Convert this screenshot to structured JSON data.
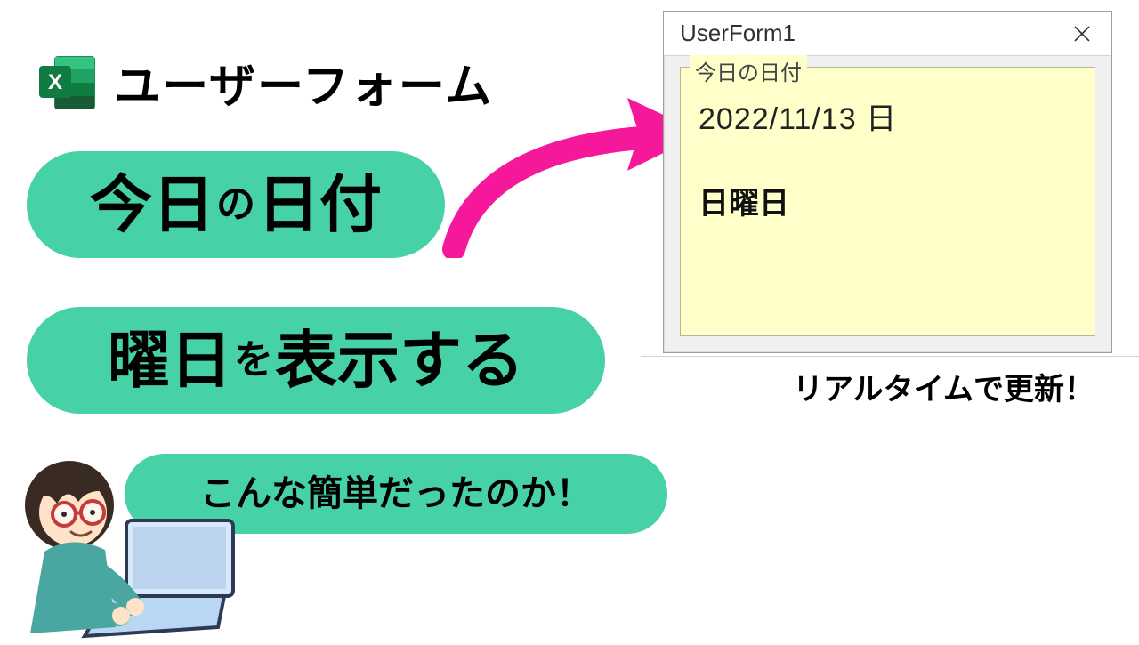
{
  "header": {
    "text": "ユーザーフォーム",
    "excel_color1": "#107C41",
    "excel_color2": "#21A366",
    "excel_letter": "X"
  },
  "pills": {
    "pill1_big1": "今日",
    "pill1_small": "の",
    "pill1_big2": "日付",
    "pill2_big1": "曜日",
    "pill2_small": "を",
    "pill2_big2": "表示する",
    "pill3_text": "こんな簡単だったのか！"
  },
  "arrow_color": "#f6189b",
  "userform": {
    "title": "UserForm1",
    "frame_caption": "今日の日付",
    "date_text": "2022/11/13 日",
    "day_text": "日曜日"
  },
  "realtime_text": "リアルタイムで更新！"
}
